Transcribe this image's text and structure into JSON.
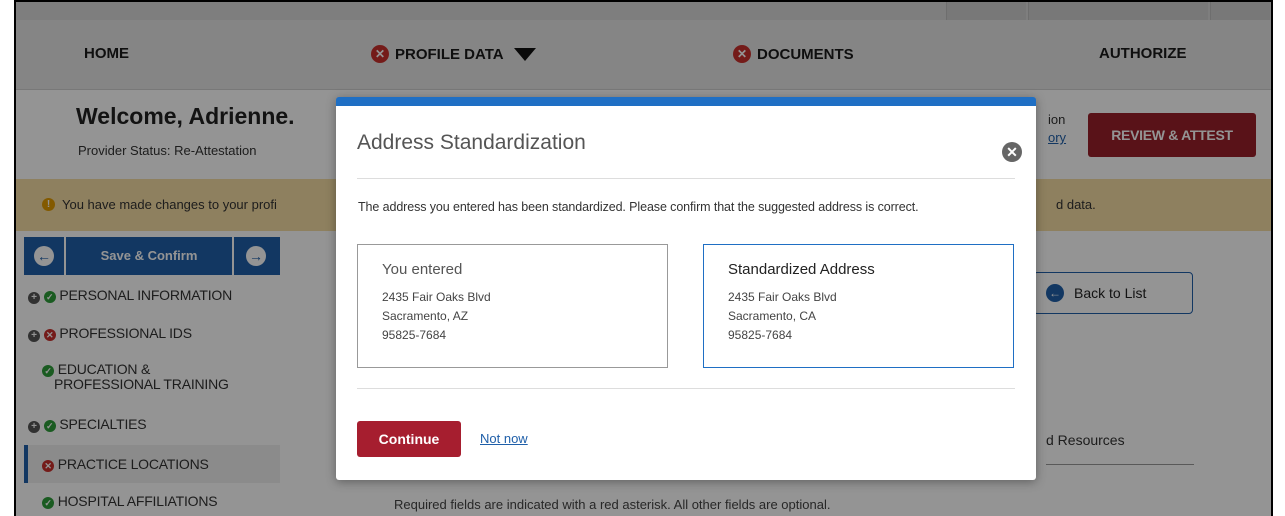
{
  "nav": {
    "home": "HOME",
    "profile_data": "PROFILE DATA",
    "documents": "DOCUMENTS",
    "authorize": "AUTHORIZE"
  },
  "header": {
    "welcome": "Welcome, Adrienne.",
    "provider_status": "Provider Status: Re-Attestation",
    "right_text_1": "ion",
    "right_link": "ory",
    "review_button": "REVIEW & ATTEST"
  },
  "alert": {
    "message": "You have made changes to your profi",
    "message_tail": "d data."
  },
  "sidebar": {
    "save_confirm": "Save & Confirm",
    "items": [
      {
        "label": "PERSONAL INFORMATION"
      },
      {
        "label": "PROFESSIONAL IDS"
      },
      {
        "label": "EDUCATION &"
      },
      {
        "label": "PROFESSIONAL TRAINING"
      },
      {
        "label": "SPECIALTIES"
      },
      {
        "label": "PRACTICE LOCATIONS"
      },
      {
        "label": "HOSPITAL AFFILIATIONS"
      }
    ]
  },
  "main": {
    "back_to_list": "Back to List",
    "resources": "d Resources",
    "required_note": "Required fields are indicated with a red asterisk. All other fields are optional."
  },
  "modal": {
    "title": "Address Standardization",
    "message": "The address you entered has been standardized. Please confirm that the suggested address is correct.",
    "entered": {
      "title": "You entered",
      "street": "2435 Fair Oaks Blvd",
      "city_state": "Sacramento, AZ",
      "zip": "95825-7684"
    },
    "standardized": {
      "title": "Standardized Address",
      "street": "2435 Fair Oaks Blvd",
      "city_state": "Sacramento, CA",
      "zip": "95825-7684"
    },
    "continue": "Continue",
    "not_now": "Not now"
  }
}
